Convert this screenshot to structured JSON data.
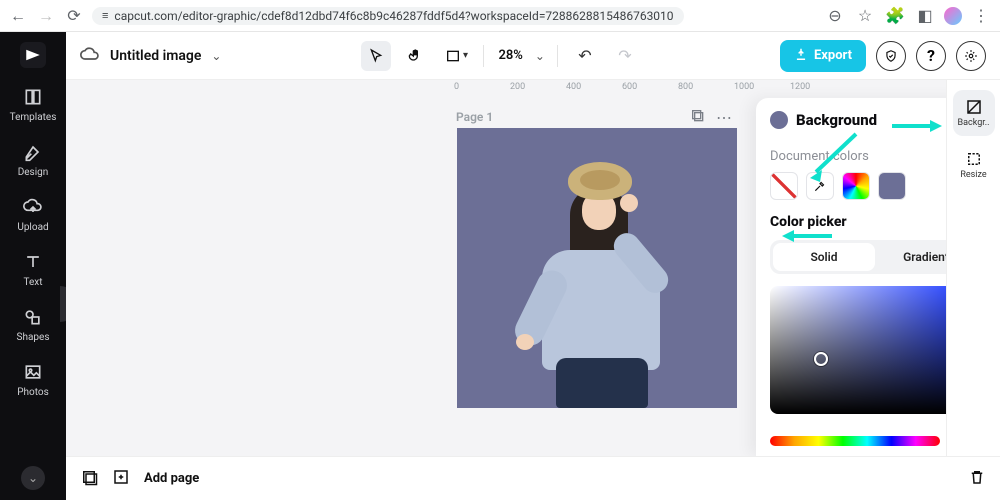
{
  "browser": {
    "url": "capcut.com/editor-graphic/cdef8d12dbd74f6c8b9c46287fddf5d4?workspaceId=7288628815486763010"
  },
  "rail": {
    "items": [
      {
        "label": "Templates"
      },
      {
        "label": "Design"
      },
      {
        "label": "Upload"
      },
      {
        "label": "Text"
      },
      {
        "label": "Shapes"
      },
      {
        "label": "Photos"
      }
    ]
  },
  "toolbar": {
    "title": "Untitled image",
    "zoom": "28%",
    "export": "Export"
  },
  "ruler": {
    "t0": "0",
    "t200": "200",
    "t400": "400",
    "t600": "600",
    "t800": "800",
    "t1000": "1000",
    "t1200": "1200"
  },
  "page": {
    "label": "Page 1"
  },
  "right_sidebar": {
    "background": "Backgr..",
    "resize": "Resize"
  },
  "panel": {
    "title": "Background",
    "doc_colors": "Document colors",
    "picker": "Color picker",
    "tab_solid": "Solid",
    "tab_gradient": "Gradient"
  },
  "bottom": {
    "add_page": "Add page"
  },
  "colors": {
    "canvas_bg": "#6c6f96",
    "accent": "#17c5e6"
  }
}
